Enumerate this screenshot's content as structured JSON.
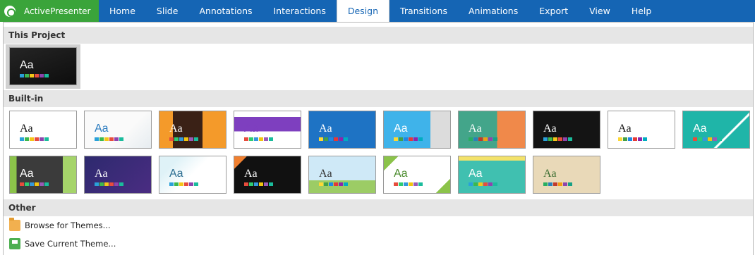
{
  "app": {
    "name": "ActivePresenter"
  },
  "menu": {
    "tabs": [
      "Home",
      "Slide",
      "Annotations",
      "Interactions",
      "Design",
      "Transitions",
      "Animations",
      "Export",
      "View",
      "Help"
    ],
    "active": "Design"
  },
  "sections": {
    "project": "This Project",
    "builtin": "Built-in",
    "other": "Other"
  },
  "theme_sample": "Aa",
  "other_actions": {
    "browse": "Browse for Themes...",
    "save": "Save Current Theme..."
  },
  "colors": {
    "ribbon": "#1565b4",
    "app_button": "#3aa43a"
  }
}
